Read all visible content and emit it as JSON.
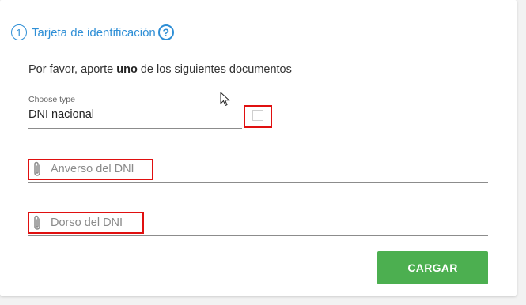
{
  "header": {
    "step": "1",
    "title": "Tarjeta de identificación",
    "help_icon": "?"
  },
  "intro": {
    "prefix": "Por favor, aporte ",
    "bold": "uno",
    "suffix": " de los siguientes documentos"
  },
  "document_type": {
    "label": "Choose type",
    "value": "DNI nacional"
  },
  "files": [
    {
      "placeholder": "Anverso del DNI",
      "icon": "paperclip-icon"
    },
    {
      "placeholder": "Dorso del DNI",
      "icon": "paperclip-icon"
    }
  ],
  "submit": {
    "label": "CARGAR"
  },
  "colors": {
    "accent": "#2f8fd6",
    "button": "#4caf50",
    "highlight": "#e01010"
  }
}
